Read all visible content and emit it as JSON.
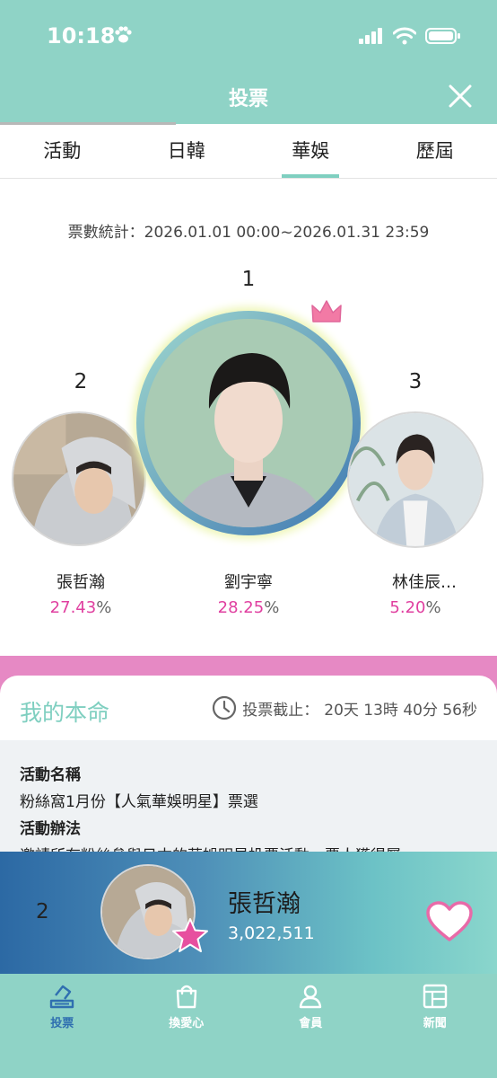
{
  "status": {
    "time": "10:18"
  },
  "header": {
    "title": "投票"
  },
  "tabs": [
    {
      "label": "活動"
    },
    {
      "label": "日韓"
    },
    {
      "label": "華娛"
    },
    {
      "label": "歷屆"
    }
  ],
  "ranking": {
    "range": "票數統計：2026.01.01 00:00~2026.01.31 23:59",
    "first": {
      "rank": "1",
      "name": "劉宇寧",
      "percent": "28.25",
      "sign": "%"
    },
    "second": {
      "rank": "2",
      "name": "張哲瀚",
      "percent": "27.43",
      "sign": "%"
    },
    "third": {
      "rank": "3",
      "name": "林佳辰…",
      "percent": "5.20",
      "sign": "%"
    }
  },
  "my_section": {
    "title": "我的本命",
    "deadline_label": "投票截止：",
    "deadline_value": "20天 13時 40分 56秒",
    "activity_name_label": "活動名稱",
    "activity_name": "粉絲窩1月份【人氣華娛明星】票選",
    "activity_rules_label": "活動辦法",
    "activity_rules": "邀請所有粉絲參與日本的華娛明星投票活動，票人獲得屬"
  },
  "favorite": {
    "rank": "2",
    "name": "張哲瀚",
    "votes": "3,022,511"
  },
  "nav": [
    {
      "label": "投票",
      "icon": "vote-icon"
    },
    {
      "label": "換愛心",
      "icon": "shopping-bag-icon"
    },
    {
      "label": "會員",
      "icon": "user-icon"
    },
    {
      "label": "新聞",
      "icon": "news-icon"
    }
  ],
  "colors": {
    "accent": "#8fd3c6",
    "pink": "#e689c4",
    "percent": "#e040a0",
    "active_nav": "#2f6fb0"
  }
}
